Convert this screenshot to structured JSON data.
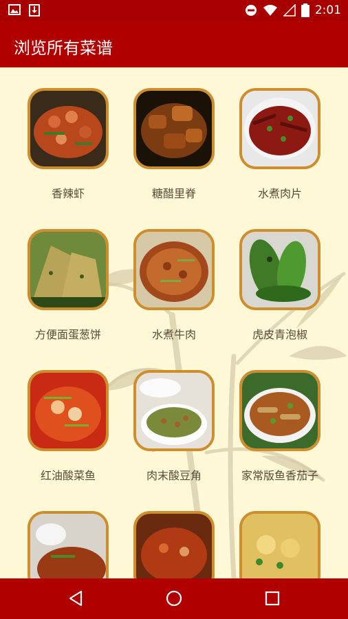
{
  "status_bar": {
    "time": "2:01"
  },
  "app_bar": {
    "title": "浏览所有菜谱"
  },
  "recipes": [
    {
      "name": "香辣虾"
    },
    {
      "name": "糖醋里脊"
    },
    {
      "name": "水煮肉片"
    },
    {
      "name": "方便面蛋葱饼"
    },
    {
      "name": "水煮牛肉"
    },
    {
      "name": "虎皮青泡椒"
    },
    {
      "name": "红油酸菜鱼"
    },
    {
      "name": "肉末酸豆角"
    },
    {
      "name": "家常版鱼香茄子"
    }
  ],
  "colors": {
    "bar": "#b00000",
    "background": "#fff8d6",
    "frame": "#cf8e2e"
  }
}
